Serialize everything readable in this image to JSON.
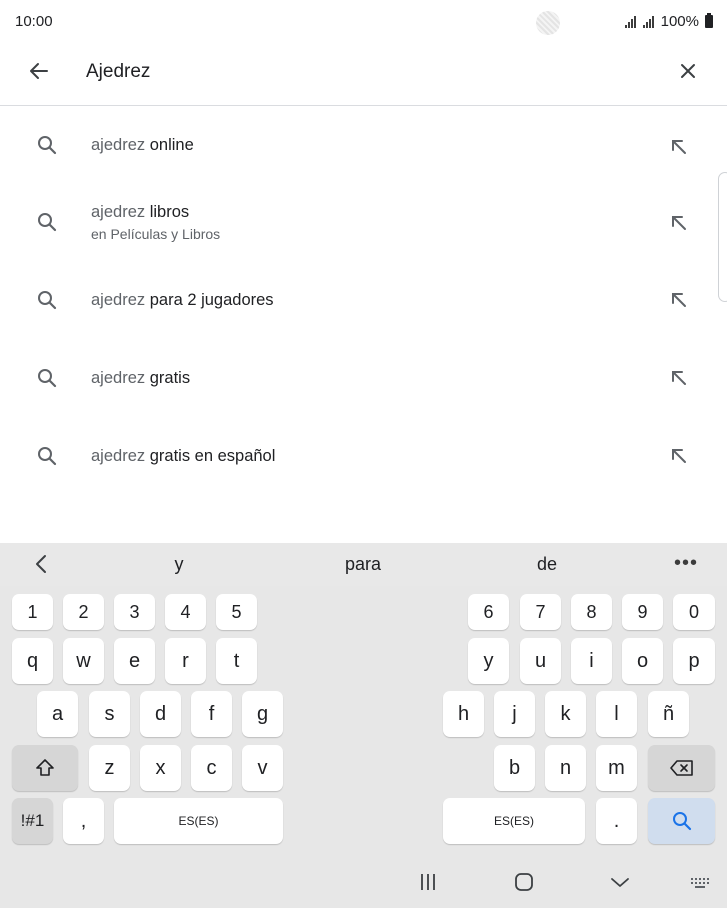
{
  "status_bar": {
    "time": "10:00",
    "battery": "100%"
  },
  "search": {
    "query": "Ajedrez",
    "icons": {
      "back": "arrow-left-icon",
      "clear": "close-icon"
    }
  },
  "suggestions": [
    {
      "prefix": "ajedrez",
      "suffix": "online",
      "subtitle": ""
    },
    {
      "prefix": "ajedrez",
      "suffix": "libros",
      "subtitle": "en Películas y Libros"
    },
    {
      "prefix": "ajedrez",
      "suffix": "para 2 jugadores",
      "subtitle": ""
    },
    {
      "prefix": "ajedrez",
      "suffix": "gratis",
      "subtitle": ""
    },
    {
      "prefix": "ajedrez",
      "suffix": "gratis en español",
      "subtitle": ""
    }
  ],
  "keyboard": {
    "predictions": [
      "y",
      "para",
      "de"
    ],
    "more": "•••",
    "numbers_left": [
      "1",
      "2",
      "3",
      "4",
      "5"
    ],
    "numbers_right": [
      "6",
      "7",
      "8",
      "9",
      "0"
    ],
    "row1_left": [
      "q",
      "w",
      "e",
      "r",
      "t"
    ],
    "row1_right": [
      "y",
      "u",
      "i",
      "o",
      "p"
    ],
    "row2_left": [
      "a",
      "s",
      "d",
      "f",
      "g"
    ],
    "row2_right": [
      "h",
      "j",
      "k",
      "l",
      "ñ"
    ],
    "row3_left": [
      "z",
      "x",
      "c",
      "v"
    ],
    "row3_right": [
      "b",
      "n",
      "m"
    ],
    "symbols": "!#1",
    "comma": ",",
    "period": ".",
    "space_left": "ES(ES)",
    "space_right": "ES(ES)"
  },
  "colors": {
    "accent": "#1a73e8",
    "keyboard_bg": "#e7e7e7",
    "key_bg": "#ffffff",
    "search_key_bg": "#d0ddee"
  }
}
